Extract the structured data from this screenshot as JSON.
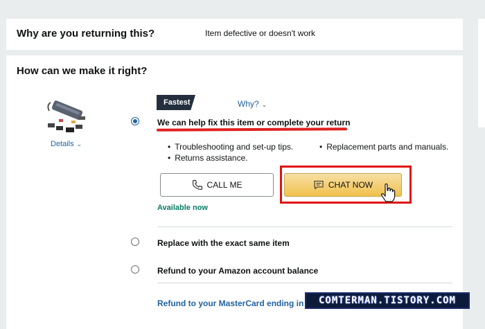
{
  "question": {
    "title": "Why are you returning this?",
    "value": "Item defective or doesn't work"
  },
  "resolution": {
    "title": "How can we make it right?",
    "details_label": "Details",
    "badge": "Fastest",
    "why_label": "Why?",
    "option_fix": {
      "label": "We can help fix this item or complete your return",
      "selected": true,
      "bullets": [
        "Troubleshooting and set-up tips.",
        "Replacement parts and manuals.",
        "Returns assistance."
      ],
      "call_label": "CALL ME",
      "chat_label": "CHAT NOW",
      "availability": "Available now"
    },
    "option_replace": {
      "label": "Replace with the exact same item",
      "selected": false
    },
    "option_refund_balance": {
      "label": "Refund to your Amazon account balance",
      "selected": false
    },
    "option_refund_card": {
      "label": "Refund to your MasterCard ending in 606"
    }
  },
  "watermark": "COMTERMAN.TISTORY.COM",
  "colors": {
    "link": "#2162a1",
    "badge_bg": "#232f3e",
    "chat_button": "#f0c14b",
    "available": "#067d62",
    "annotation": "#e01010"
  },
  "icons": [
    "product-image",
    "chevron-down-icon",
    "phone-icon",
    "chat-icon",
    "hand-cursor-icon"
  ]
}
